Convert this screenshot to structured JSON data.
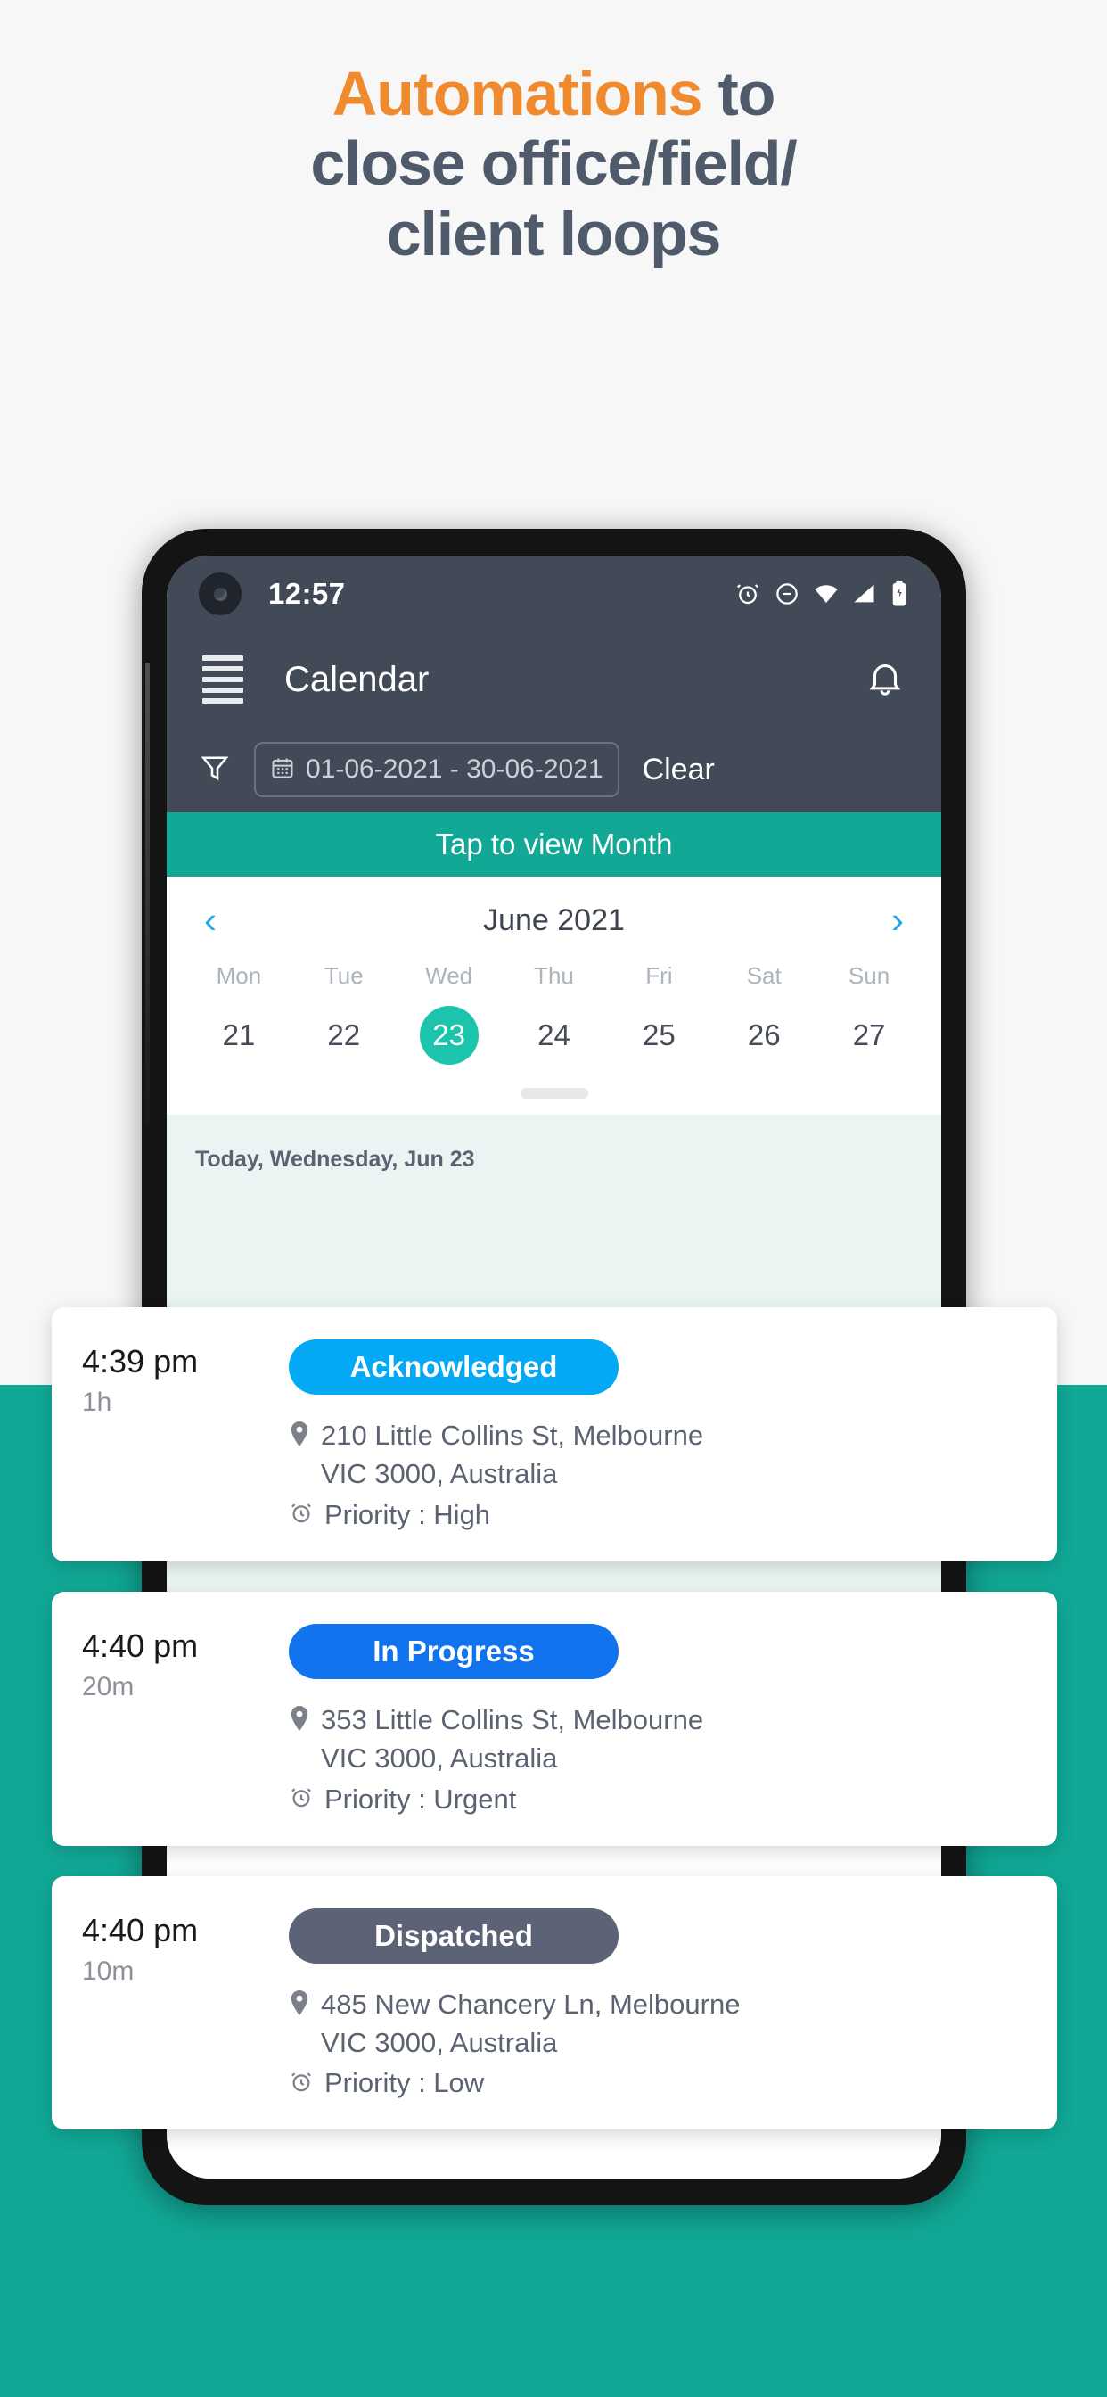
{
  "hero": {
    "headline_accent": "Automations",
    "headline_rest": " to",
    "headline_line2": "close office/field/",
    "headline_line3": "client loops",
    "accent_color": "#f08a2e",
    "text_color": "#4f5b6a",
    "background": "#f7f7f7",
    "band_color": "#11a896"
  },
  "phone": {
    "statusbar": {
      "time": "12:57",
      "icons": [
        "alarm-icon",
        "do-not-disturb-icon",
        "wifi-icon",
        "signal-icon",
        "battery-icon"
      ]
    },
    "appbar": {
      "menu_icon": "hamburger-icon",
      "title": "Calendar",
      "notification_icon": "bell-icon"
    },
    "filterbar": {
      "filter_icon": "funnel-icon",
      "calendar_icon": "calendar-icon",
      "date_range": "01-06-2021 - 30-06-2021",
      "clear_label": "Clear"
    },
    "month_bar": {
      "label": "Tap to view Month",
      "color": "#11a896"
    },
    "calendar": {
      "prev_icon": "chevron-left-icon",
      "next_icon": "chevron-right-icon",
      "month_title": "June 2021",
      "weekdays": [
        "Mon",
        "Tue",
        "Wed",
        "Thu",
        "Fri",
        "Sat",
        "Sun"
      ],
      "days": [
        "21",
        "22",
        "23",
        "24",
        "25",
        "26",
        "27"
      ],
      "selected_index": 2,
      "selected_color": "#1cc4ac"
    },
    "day_header": "Today, Wednesday, Jun 23"
  },
  "events": [
    {
      "time": "4:39 pm",
      "duration": "1h",
      "status": "Acknowledged",
      "status_color": "#03a9f4",
      "address_line1": "210 Little Collins St, Melbourne",
      "address_line2": "VIC 3000, Australia",
      "priority": "Priority : High",
      "location_icon": "map-pin-icon",
      "priority_icon": "alarm-clock-icon"
    },
    {
      "time": "4:40 pm",
      "duration": "20m",
      "status": "In Progress",
      "status_color": "#1273ef",
      "address_line1": "353 Little Collins St, Melbourne",
      "address_line2": "VIC 3000, Australia",
      "priority": "Priority : Urgent",
      "location_icon": "map-pin-icon",
      "priority_icon": "alarm-clock-icon"
    },
    {
      "time": "4:40 pm",
      "duration": "10m",
      "status": "Dispatched",
      "status_color": "#5c6377",
      "address_line1": "485 New Chancery Ln, Melbourne",
      "address_line2": "VIC 3000, Australia",
      "priority": "Priority : Low",
      "location_icon": "map-pin-icon",
      "priority_icon": "alarm-clock-icon"
    }
  ]
}
